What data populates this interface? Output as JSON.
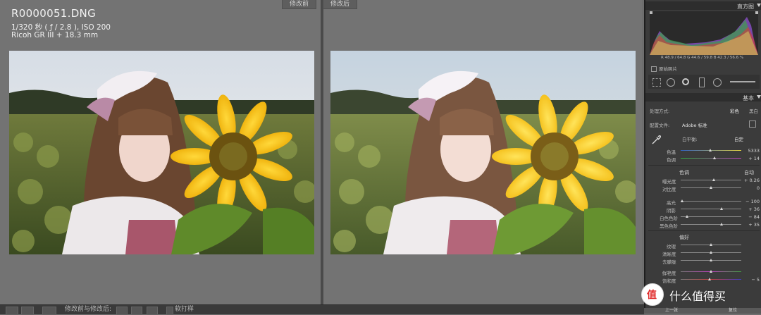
{
  "viewer": {
    "file_name": "R0000051.DNG",
    "exif": "1/320 秒 ( ƒ / 2.8 ),  ISO 200",
    "camera": "Ricoh GR III + 18.3 mm",
    "before_label": "修改前",
    "after_label": "修改后"
  },
  "toolbar": {
    "before_after_label": "修改前与修改后:",
    "soft_proof_label": "软打样"
  },
  "panel": {
    "histogram_title": "直方图",
    "rgb_readout": "R 48.9 / 64.8  G 44.6 / 59.8  B 42.3 / 56.6  %",
    "original_photo": "原始照片",
    "basic_title": "基本",
    "treatment_label": "处理方式:",
    "color_option": "彩色",
    "bw_option": "黑白",
    "profile_label": "配置文件:",
    "profile_value": "Adobe 标准",
    "white_balance_label": "白平衡:",
    "white_balance_value": "自定",
    "temp_label": "色温",
    "temp_value": "5333",
    "tint_label": "色调",
    "tint_value": "+ 14",
    "tone_label": "色调",
    "auto_label": "自动",
    "exposure_label": "曝光度",
    "exposure_value": "+ 0.26",
    "contrast_label": "对比度",
    "contrast_value": "0",
    "highlights_label": "高光",
    "highlights_value": "− 100",
    "shadows_label": "阴影",
    "shadows_value": "+ 36",
    "whites_label": "白色色阶",
    "whites_value": "− 84",
    "blacks_label": "黑色色阶",
    "blacks_value": "+ 35",
    "presence_label": "偏好",
    "texture_label": "纹理",
    "clarity_label": "清晰度",
    "dehaze_label": "去朦胧",
    "vibrance_label": "鲜艳度",
    "saturation_label": "饱和度",
    "saturation_value": "− 5",
    "prev_label": "上一张",
    "reset_label": "复位"
  },
  "watermark": {
    "text": "什么值得买",
    "logo_glyph": "值"
  },
  "colors": {
    "panel_bg": "#3b3b3b",
    "viewer_bg": "#737373",
    "sky": "#dfe4ea",
    "sunflower": "#f2c21a"
  }
}
